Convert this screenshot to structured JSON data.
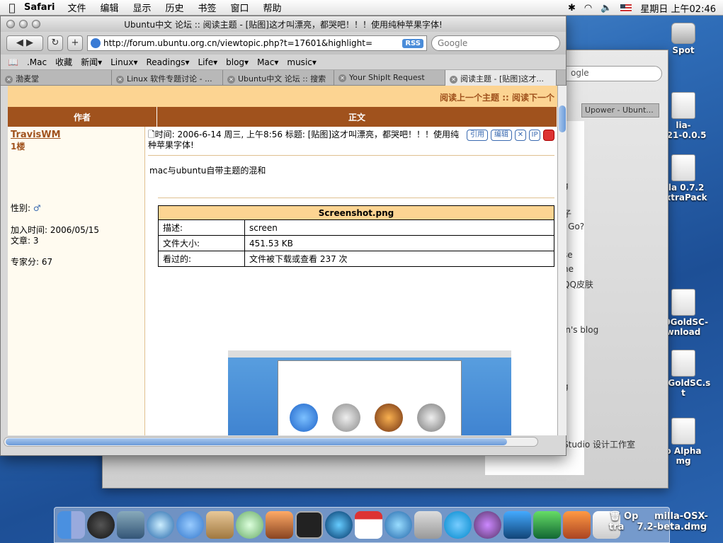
{
  "menubar": {
    "app": "Safari",
    "items": [
      "文件",
      "编辑",
      "显示",
      "历史",
      "书签",
      "窗口",
      "帮助"
    ],
    "clock": "星期日 上午02:46"
  },
  "desktop": {
    "icons": [
      {
        "label": "Spot"
      },
      {
        "label": "lia-\n..21-0.0.5"
      },
      {
        "label": "illa 0.7.2\nExtraPack"
      },
      {
        "label": "10GoldSC-\nwnload"
      },
      {
        "label": "10GoldSC.s\nt"
      },
      {
        "label": "o Alpha\nmg"
      },
      {
        "label": "Op     milla-OSX-\ntra    7.2-beta.dmg"
      }
    ]
  },
  "bgwindow": {
    "search_placeholder": "ogle",
    "tab": "Upower - Ubunt...",
    "lines": [
      "g",
      "子",
      "l Go?",
      "se",
      "ne",
      "QQ皮肤",
      "in's blog",
      "g",
      "Studio 设计工作室"
    ]
  },
  "window": {
    "title": "Ubuntu中文 论坛 :: 阅读主题 - [贴图]这才叫漂亮，都哭吧！！！使用纯种苹果字体!",
    "url": "http://forum.ubuntu.org.cn/viewtopic.php?t=17601&highlight=",
    "rss": "RSS",
    "search_placeholder": "Google",
    "bookmarks": [
      ".Mac",
      "收藏",
      "新闻▾",
      "Linux▾",
      "Readings▾",
      "Life▾",
      "blog▾",
      "Mac▾",
      "music▾"
    ],
    "tabs": [
      {
        "label": "渤麦堂",
        "active": false
      },
      {
        "label": "Linux 软件专题讨论 - ...",
        "active": false
      },
      {
        "label": "Ubuntu中文 论坛 :: 搜索",
        "active": false
      },
      {
        "label": "Your ShipIt Request",
        "active": false
      },
      {
        "label": "阅读主题 - [贴图]这才...",
        "active": true
      }
    ]
  },
  "forum": {
    "nav": "阅读上一个主题 :: 阅读下一个",
    "col_author": "作者",
    "col_body": "正文",
    "author": {
      "name": "TravisWM",
      "floor": "1楼",
      "gender_label": "性别:",
      "joined": "加入时间: 2006/05/15",
      "posts": "文章: 3",
      "score": "专家分: 67"
    },
    "post": {
      "header": "时间: 2006-6-14 周三, 上午8:56    标题: [贴图]这才叫漂亮，都哭吧！！！使用纯种苹果字体!",
      "buttons": {
        "quote": "引用",
        "edit": "编辑",
        "ip": "IP"
      },
      "message": "mac与ubuntu自带主题的混和"
    },
    "attachment": {
      "filename": "Screenshot.png",
      "rows": [
        {
          "label": "描述:",
          "value": "screen"
        },
        {
          "label": "文件大小:",
          "value": "451.53 KB"
        },
        {
          "label": "看过的:",
          "value": "文件被下载或查看 237 次"
        }
      ]
    }
  },
  "colors": {
    "forum_brown": "#a0521d",
    "forum_light": "#fcd492"
  }
}
